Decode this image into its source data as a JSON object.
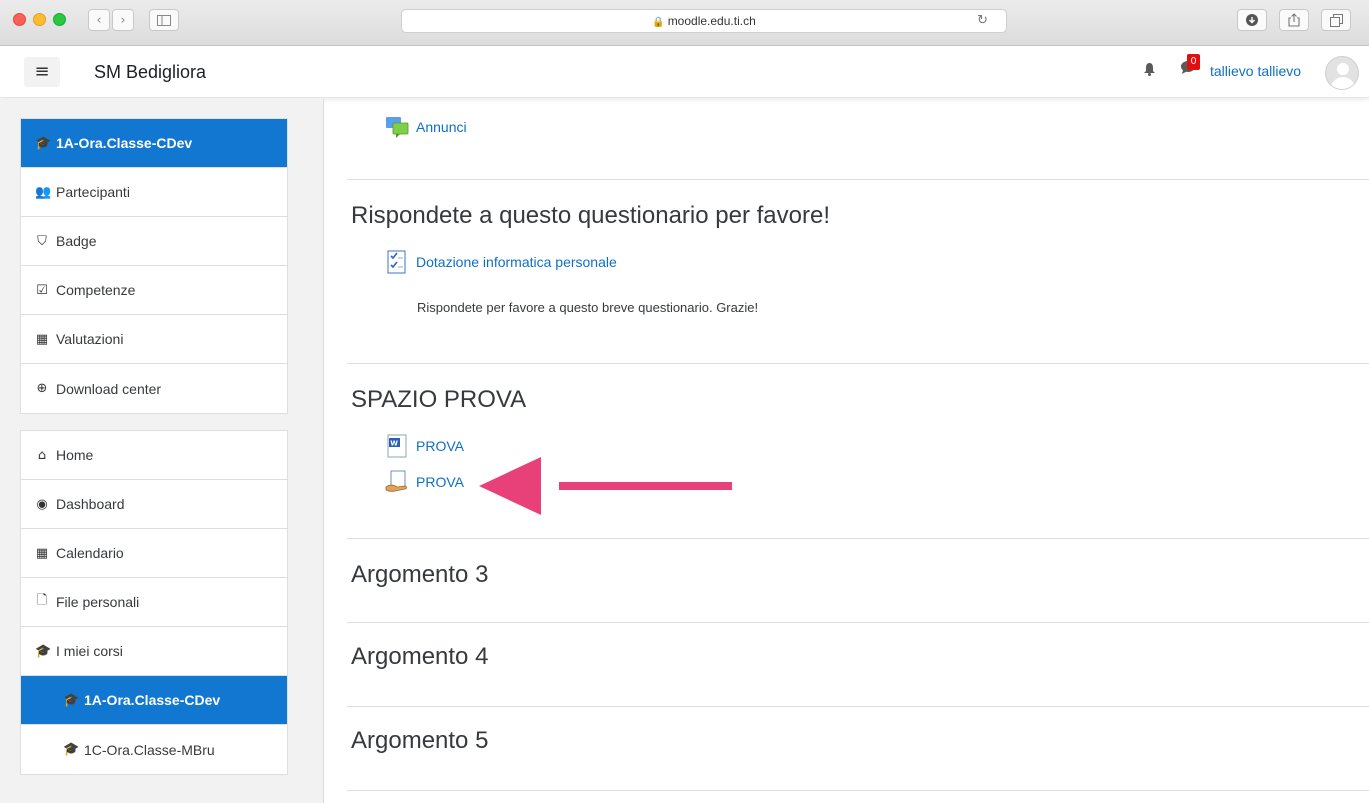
{
  "browser": {
    "url": "moodle.edu.ti.ch",
    "back_glyph": "‹",
    "forward_glyph": "›",
    "lock_glyph": "🔒",
    "reload_glyph": "↻"
  },
  "navbar": {
    "menu_glyph": "≡",
    "site_title": "SM Bedigliora",
    "chat_badge": "0",
    "username": "tallievo tallievo"
  },
  "course_nav": [
    {
      "label": "1A-Ora.Classe-CDev",
      "icon": "graduation-cap-icon",
      "glyph": "🎓"
    },
    {
      "label": "Partecipanti",
      "icon": "users-icon",
      "glyph": "👥"
    },
    {
      "label": "Badge",
      "icon": "shield-icon",
      "glyph": "⛉"
    },
    {
      "label": "Competenze",
      "icon": "checkbox-icon",
      "glyph": "☑"
    },
    {
      "label": "Valutazioni",
      "icon": "table-icon",
      "glyph": "▦"
    },
    {
      "label": "Download center",
      "icon": "download-icon",
      "glyph": "⊕"
    }
  ],
  "site_nav": [
    {
      "label": "Home",
      "icon": "home-icon",
      "glyph": "⌂"
    },
    {
      "label": "Dashboard",
      "icon": "dashboard-icon",
      "glyph": "◉"
    },
    {
      "label": "Calendario",
      "icon": "calendar-icon",
      "glyph": "▦"
    },
    {
      "label": "File personali",
      "icon": "file-icon",
      "glyph": "🗋"
    },
    {
      "label": "I miei corsi",
      "icon": "graduation-cap-icon",
      "glyph": "🎓"
    },
    {
      "label": "1A-Ora.Classe-CDev",
      "icon": "graduation-cap-icon",
      "glyph": "🎓"
    },
    {
      "label": "1C-Ora.Classe-MBru",
      "icon": "graduation-cap-icon",
      "glyph": "🎓"
    }
  ],
  "sections": {
    "announcements": {
      "activity": "Annunci"
    },
    "questionnaire": {
      "title": "Rispondete a questo questionario per favore!",
      "activity": "Dotazione informatica personale",
      "summary": "Rispondete per favore a questo breve questionario. Grazie!"
    },
    "prova": {
      "title": "SPAZIO PROVA",
      "activity_1": "PROVA",
      "activity_2": "PROVA"
    },
    "topic3": {
      "title": "Argomento 3"
    },
    "topic4": {
      "title": "Argomento 4"
    },
    "topic5": {
      "title": "Argomento 5"
    }
  },
  "colors": {
    "accent": "#1177d1",
    "link": "#0f6fc5",
    "annotation_arrow": "#e8417a"
  }
}
